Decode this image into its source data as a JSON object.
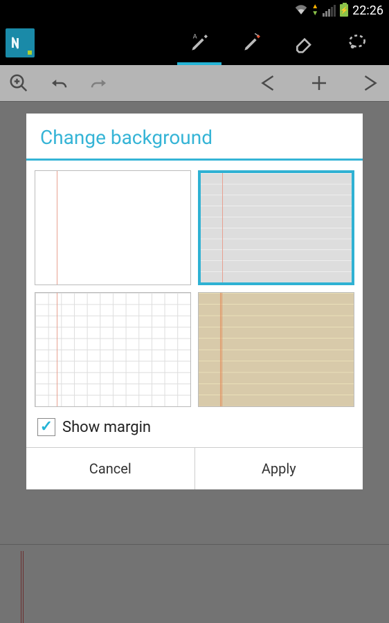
{
  "status": {
    "time": "22:26"
  },
  "dialog": {
    "title": "Change background",
    "show_margin_label": "Show margin",
    "show_margin_checked": true,
    "cancel": "Cancel",
    "apply": "Apply",
    "selected_index": 1,
    "options": [
      {
        "name": "blank-margin"
      },
      {
        "name": "lined"
      },
      {
        "name": "grid"
      },
      {
        "name": "legal"
      }
    ]
  }
}
